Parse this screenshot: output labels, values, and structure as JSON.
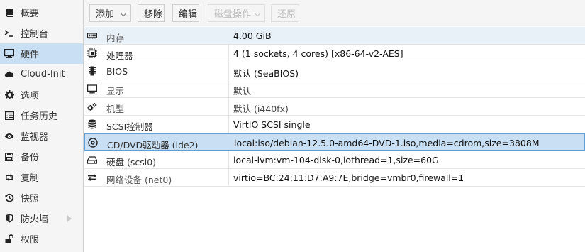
{
  "sidebar": {
    "items": [
      {
        "label": "概要",
        "icon": "book-icon",
        "selected": false
      },
      {
        "label": "控制台",
        "icon": "terminal-icon",
        "selected": false
      },
      {
        "label": "硬件",
        "icon": "desktop-icon",
        "selected": true
      },
      {
        "label": "Cloud-Init",
        "icon": "cloud-icon",
        "selected": false
      },
      {
        "label": "选项",
        "icon": "gear-icon",
        "selected": false
      },
      {
        "label": "任务历史",
        "icon": "list-icon",
        "selected": false
      },
      {
        "label": "监视器",
        "icon": "eye-icon",
        "selected": false
      },
      {
        "label": "备份",
        "icon": "floppy-icon",
        "selected": false
      },
      {
        "label": "复制",
        "icon": "retweet-icon",
        "selected": false
      },
      {
        "label": "快照",
        "icon": "history-icon",
        "selected": false
      },
      {
        "label": "防火墙",
        "icon": "shield-icon",
        "selected": false,
        "has_submenu": true
      },
      {
        "label": "权限",
        "icon": "unlock-icon",
        "selected": false
      }
    ]
  },
  "toolbar": {
    "add_label": "添加",
    "remove_label": "移除",
    "edit_label": "编辑",
    "disk_action_label": "磁盘操作",
    "revert_label": "还原"
  },
  "hardware": {
    "rows": [
      {
        "key": "内存",
        "value": "4.00 GiB",
        "icon": "memory-icon",
        "key_muted": true
      },
      {
        "key": "处理器",
        "value": "4 (1 sockets, 4 cores) [x86-64-v2-AES]",
        "icon": "cpu-icon",
        "key_muted": false
      },
      {
        "key": "BIOS",
        "value": "默认 (SeaBIOS)",
        "icon": "microchip-icon",
        "key_muted": false
      },
      {
        "key": "显示",
        "value": "默认",
        "icon": "monitor-icon",
        "key_muted": true
      },
      {
        "key": "机型",
        "value": "默认 (i440fx)",
        "icon": "cogs-icon",
        "key_muted": true
      },
      {
        "key": "SCSI控制器",
        "value": "VirtIO SCSI single",
        "icon": "database-icon",
        "key_muted": false
      },
      {
        "key": "CD/DVD驱动器 (ide2)",
        "value": "local:iso/debian-12.5.0-amd64-DVD-1.iso,media=cdrom,size=3808M",
        "icon": "cdrom-icon",
        "key_muted": false
      },
      {
        "key": "硬盘 (scsi0)",
        "value": "local-lvm:vm-104-disk-0,iothread=1,size=60G",
        "icon": "hdd-icon",
        "key_muted": false
      },
      {
        "key": "网络设备 (net0)",
        "value": "virtio=BC:24:11:D7:A9:7E,bridge=vmbr0,firewall=1",
        "icon": "exchange-icon",
        "key_muted": true
      }
    ]
  },
  "colors": {
    "selection": "#c9dff3",
    "selection_border": "#5f9fd6",
    "alt_row": "#e8f0f8",
    "panel_bg": "#f5f5f5"
  }
}
